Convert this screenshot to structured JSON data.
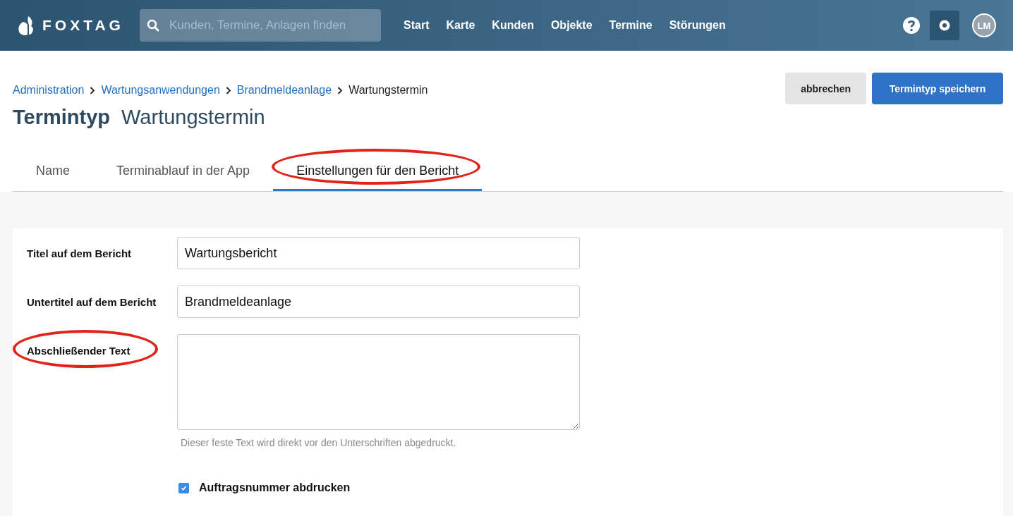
{
  "header": {
    "logo": "FOXTAG",
    "search": {
      "placeholder": "Kunden, Termine, Anlagen finden"
    },
    "nav": [
      "Start",
      "Karte",
      "Kunden",
      "Objekte",
      "Termine",
      "Störungen"
    ],
    "avatar": "LM"
  },
  "breadcrumb": [
    {
      "label": "Administration",
      "link": true
    },
    {
      "label": "Wartungsanwendungen",
      "link": true
    },
    {
      "label": "Brandmeldeanlage",
      "link": true
    },
    {
      "label": "Wartungstermin",
      "link": false
    }
  ],
  "buttons": [
    {
      "label": "abbrechen",
      "kind": "secondary"
    },
    {
      "label": "Termintyp speichern",
      "kind": "primary"
    }
  ],
  "title": {
    "type": "Termintyp",
    "name": "Wartungstermin"
  },
  "tabs": [
    {
      "label": "Name",
      "selected": false,
      "circled": false
    },
    {
      "label": "Terminablauf in der App",
      "selected": false,
      "circled": false
    },
    {
      "label": "Einstellungen für den Bericht",
      "selected": true,
      "circled": true
    }
  ],
  "form": [
    {
      "kind": "input",
      "label": "Titel auf dem Bericht",
      "value": "Wartungsbericht",
      "circled": false
    },
    {
      "kind": "input",
      "label": "Untertitel auf dem Bericht",
      "value": "Brandmeldeanlage",
      "circled": false
    },
    {
      "kind": "textarea",
      "label": "Abschließender Text",
      "hint": "Dieser feste Text wird direkt vor den Unterschriften abgedruckt.",
      "circled": true
    },
    {
      "kind": "checkbox",
      "label": "Auftragsnummer abdrucken",
      "checked": true
    }
  ]
}
